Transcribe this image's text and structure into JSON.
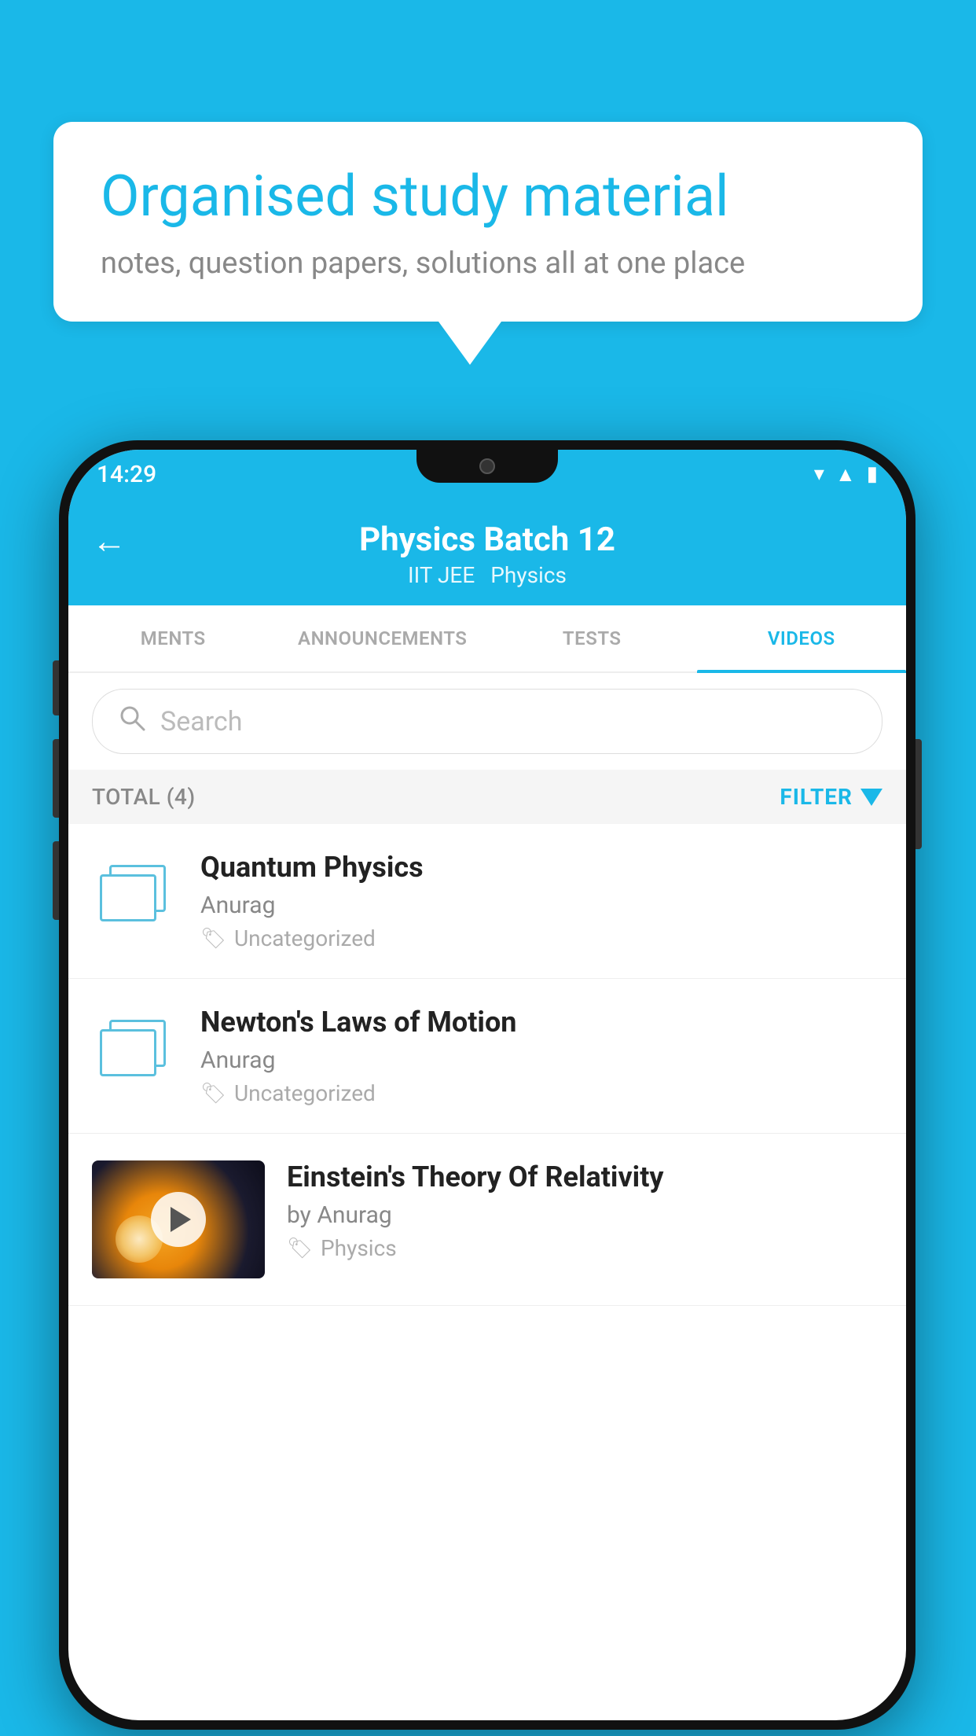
{
  "background_color": "#1ab8e8",
  "bubble": {
    "title": "Organised study material",
    "subtitle": "notes, question papers, solutions all at one place"
  },
  "status_bar": {
    "time": "14:29",
    "icons": [
      "wifi",
      "signal",
      "battery"
    ]
  },
  "header": {
    "title": "Physics Batch 12",
    "subtitle_tags": [
      "IIT JEE",
      "Physics"
    ],
    "back_label": "←"
  },
  "tabs": [
    {
      "label": "MENTS",
      "active": false
    },
    {
      "label": "ANNOUNCEMENTS",
      "active": false
    },
    {
      "label": "TESTS",
      "active": false
    },
    {
      "label": "VIDEOS",
      "active": true
    }
  ],
  "search": {
    "placeholder": "Search"
  },
  "filter_row": {
    "total_label": "TOTAL (4)",
    "filter_label": "FILTER"
  },
  "videos": [
    {
      "title": "Quantum Physics",
      "author": "Anurag",
      "tag": "Uncategorized",
      "type": "folder"
    },
    {
      "title": "Newton's Laws of Motion",
      "author": "Anurag",
      "tag": "Uncategorized",
      "type": "folder"
    },
    {
      "title": "Einstein's Theory Of Relativity",
      "author": "by Anurag",
      "tag": "Physics",
      "type": "video"
    }
  ]
}
